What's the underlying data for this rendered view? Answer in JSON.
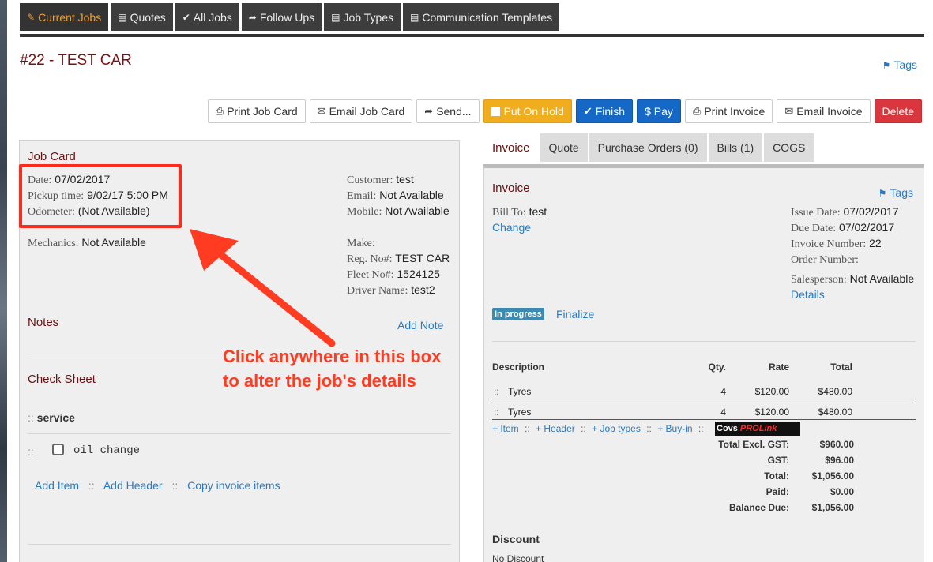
{
  "nav": {
    "tabs": [
      {
        "label": "Current Jobs",
        "icon": "wrench-icon",
        "glyph": "✎"
      },
      {
        "label": "Quotes",
        "icon": "document-icon",
        "glyph": "▤"
      },
      {
        "label": "All Jobs",
        "icon": "check-icon",
        "glyph": "✔"
      },
      {
        "label": "Follow Ups",
        "icon": "share-icon",
        "glyph": "➦"
      },
      {
        "label": "Job Types",
        "icon": "file-icon",
        "glyph": "▤"
      },
      {
        "label": "Communication Templates",
        "icon": "file-icon",
        "glyph": "▤"
      }
    ]
  },
  "page": {
    "title": "#22 - TEST CAR",
    "tags_label": "Tags"
  },
  "toolbar": {
    "print_job_card": "Print Job Card",
    "email_job_card": "Email Job Card",
    "send": "Send...",
    "put_on_hold": "Put On Hold",
    "finish": "Finish",
    "pay": "$ Pay",
    "print_invoice": "Print Invoice",
    "email_invoice": "Email Invoice",
    "delete": "Delete"
  },
  "job_card": {
    "title": "Job Card",
    "date_label": "Date:",
    "date": "07/02/2017",
    "pickup_label": "Pickup time:",
    "pickup": "9/02/17 5:00 PM",
    "odometer_label": "Odometer:",
    "odometer": "(Not Available)",
    "mechanics_label": "Mechanics:",
    "mechanics": "Not Available",
    "customer_label": "Customer:",
    "customer": "test",
    "email_label": "Email:",
    "email": "Not Available",
    "mobile_label": "Mobile:",
    "mobile": "Not Available",
    "make_label": "Make:",
    "reg_label": "Reg. No#:",
    "reg": "TEST CAR",
    "fleet_label": "Fleet No#:",
    "fleet": "1524125",
    "driver_label": "Driver Name:",
    "driver": "test2",
    "notes_heading": "Notes",
    "add_note": "Add Note",
    "check_sheet_heading": "Check Sheet",
    "check_group": "service",
    "check_item": "oil change",
    "add_item": "Add Item",
    "add_header": "Add Header",
    "copy_invoice_items": "Copy invoice items",
    "sep": "::"
  },
  "annotation": {
    "line1": "Click anywhere in this box",
    "line2": "to alter the job's details",
    "color": "#ff3b22"
  },
  "right_tabs": [
    "Invoice",
    "Quote",
    "Purchase Orders (0)",
    "Bills (1)",
    "COGS"
  ],
  "invoice": {
    "title": "Invoice",
    "tags_label": "Tags",
    "bill_to_label": "Bill To:",
    "bill_to": "test",
    "change": "Change",
    "issue_date_label": "Issue Date:",
    "issue_date": "07/02/2017",
    "due_date_label": "Due Date:",
    "due_date": "07/02/2017",
    "invoice_number_label": "Invoice Number:",
    "invoice_number": "22",
    "order_number_label": "Order Number:",
    "salesperson_label": "Salesperson:",
    "salesperson": "Not Available",
    "details": "Details",
    "status_badge": "In progress",
    "finalize": "Finalize",
    "columns": [
      "Description",
      "Qty.",
      "Rate",
      "Total"
    ],
    "rows": [
      {
        "desc": "Tyres",
        "qty": "4",
        "rate": "$120.00",
        "total": "$480.00"
      },
      {
        "desc": "Tyres",
        "qty": "4",
        "rate": "$120.00",
        "total": "$480.00"
      }
    ],
    "row_handle": "::",
    "add_links": [
      "+ Item",
      "+ Header",
      "+ Job types",
      "+ Buy-in"
    ],
    "covs_logo": {
      "text1": "Covs",
      "text2": "PROLink"
    },
    "totals": [
      {
        "label": "Total Excl. GST:",
        "value": "$960.00"
      },
      {
        "label": "GST:",
        "value": "$96.00"
      },
      {
        "label": "Total:",
        "value": "$1,056.00"
      },
      {
        "label": "Paid:",
        "value": "$0.00"
      },
      {
        "label": "Balance Due:",
        "value": "$1,056.00"
      }
    ],
    "discount_heading": "Discount",
    "discount_value": "No Discount"
  }
}
